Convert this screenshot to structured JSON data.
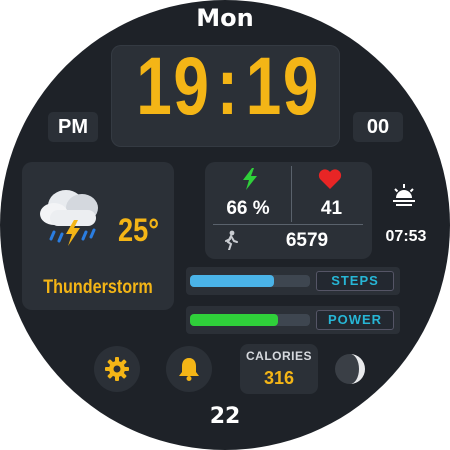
{
  "day": "Mon",
  "time": {
    "hours": "19",
    "separator": ":",
    "minutes": "19",
    "ampm": "PM",
    "seconds": "00"
  },
  "weather": {
    "temperature": "25°",
    "condition": "Thunderstorm",
    "icon": "thunderstorm-cloud-icon"
  },
  "stats": {
    "battery": "66 %",
    "heart_rate": "41",
    "steps": "6579",
    "battery_icon": "lightning-icon",
    "heart_icon": "heart-icon",
    "steps_icon": "walking-icon"
  },
  "sunrise": {
    "time": "07:53",
    "icon": "sunrise-icon"
  },
  "progress": {
    "steps": {
      "label": "STEPS",
      "fraction": 0.7,
      "color": "#4ab3e8"
    },
    "power": {
      "label": "POWER",
      "fraction": 0.73,
      "color": "#2fd03a"
    }
  },
  "calories": {
    "label": "CALORIES",
    "value": "316"
  },
  "buttons": {
    "settings_icon": "gear-icon",
    "alarm_icon": "bell-icon"
  },
  "moon_icon": "moon-phase-icon",
  "date": "22",
  "colors": {
    "accent": "#f4b516",
    "background": "#1e2228",
    "panel": "#2b3037"
  }
}
